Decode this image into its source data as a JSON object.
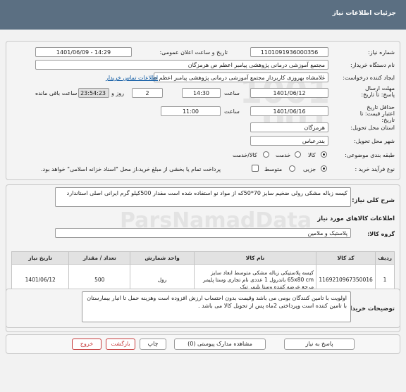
{
  "header": {
    "title": "جزئیات اطلاعات نیاز"
  },
  "form": {
    "need_number_label": "شماره نیاز:",
    "need_number": "1101091936000356",
    "announce_label": "تاریخ و ساعت اعلان عمومی:",
    "announce_value": "1401/06/09 - 14:29",
    "buyer_label": "نام دستگاه خریدار:",
    "buyer_value": "مجتمع آموزشی درمانی پژوهشی پیامبر اعظم ص  هرمزگان",
    "creator_label": "ایجاد کننده درخواست:",
    "creator_value": "غلامشاه بهروزی کاربرداز مجتمع آموزشی درمانی پژوهشی پیامبر اعظم ص  هرم",
    "contact_link": "اطلاعات تماس خریدار",
    "deadline_label": "مهلت ارسال پاسخ: تا تاریخ:",
    "deadline_date": "1401/06/12",
    "time_label": "ساعت",
    "deadline_time": "14:30",
    "day_label": "روز و",
    "days_value": "2",
    "remaining_time": "23:54:23",
    "remaining_label": "ساعت باقی مانده",
    "validity_label": "حداقل تاریخ اعتبار قیمت: تا تاریخ:",
    "validity_date": "1401/06/16",
    "validity_time_label": "ساعت",
    "validity_time": "11:00",
    "province_label": "استان محل تحویل:",
    "province_value": "هرمزگان",
    "city_label": "شهر محل تحویل:",
    "city_value": "بندرعباس",
    "category_label": "طبقه بندی موضوعی:",
    "category_options": [
      "کالا",
      "خدمت",
      "کالا/خدمت"
    ],
    "process_label": "نوع فرآیند خرید :",
    "process_options": [
      "جزیی",
      "متوسط"
    ],
    "payment_note": "پرداخت تمام یا بخشی از مبلغ خرید،از محل \"اسناد خزانه اسلامی\" خواهد بود."
  },
  "description": {
    "label": "شرح کلی نیاز:",
    "text": "کیسه زباله مشکی رولی  ضخیم سایز 70*50که از مواد نو استفاده شده است  مقدار 500کیلو گرم ایرانی اصلی  استاندارد"
  },
  "goods": {
    "section_title": "اطلاعات کالاهای مورد نیاز",
    "group_label": "گروه کالا:",
    "group_value": "پلاستیک و ملامین",
    "columns": [
      "ردیف",
      "کد کالا",
      "نام کالا",
      "واحد شمارش",
      "تعداد / مقدار",
      "تاریخ نیاز"
    ],
    "rows": [
      {
        "row": "1",
        "code": "1169210967350016",
        "name": "کیسه پلاستیکی زباله مشکی متوسط ابعاد سایز 65x80 cm باندرول 1 عددی نام تجاری وستا پلیمر مرجع عرضه کننده وستا پلیمر تیک",
        "unit": "رول",
        "qty": "500",
        "date": "1401/06/12"
      }
    ]
  },
  "buyer_notes": {
    "label": "توضیحات خریدار:",
    "text": "اولویت با تامین  کنندگان بومی  می باشد وقیمت  بدون  احتساب  ارزش  افزوده  است  وهزینه حمل  تا انبار بیمارستان  با  تامین کننده است وپرداختی 2ماه پس  از تحویل  کالا می باشد ."
  },
  "buttons": {
    "reply": "پاسخ به نیاز",
    "attachments": "مشاهده مدارک پیوستی (0)",
    "print": "چاپ",
    "back": "بازگشت",
    "exit": "خروج"
  }
}
